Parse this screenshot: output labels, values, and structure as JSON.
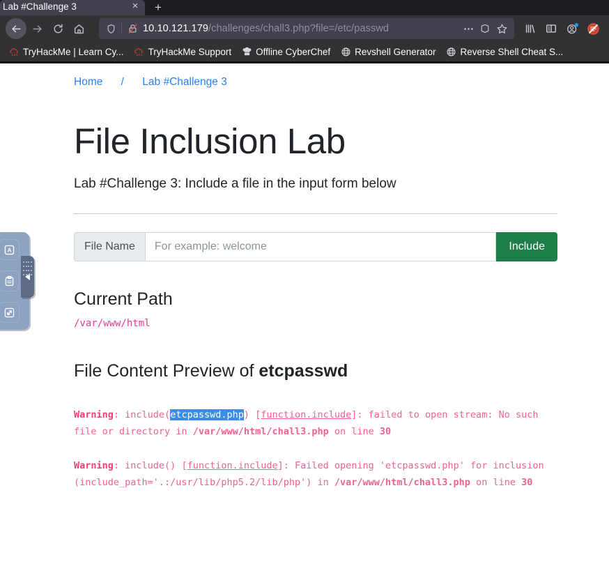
{
  "browser": {
    "tab": {
      "title": "Lab #Challenge 3",
      "close_label": "×"
    },
    "newtab_label": "+",
    "nav": {
      "back": "back-arrow",
      "forward": "forward-arrow",
      "reload": "reload",
      "home": "home"
    },
    "url": {
      "host": "10.10.121.179",
      "path": "/challenges/chall3.php?file=/etc/passwd",
      "shield_icon": "tracking-protection-shield",
      "lock_icon": "insecure-connection-crossed-lock",
      "page_actions_icon": "ellipsis",
      "reader_icon": "reader-view",
      "bookmark_icon": "star"
    },
    "toolbar_right": [
      {
        "name": "library-icon",
        "glyph": "library"
      },
      {
        "name": "sidebar-icon",
        "glyph": "sidebar"
      },
      {
        "name": "account-icon",
        "glyph": "account"
      },
      {
        "name": "noscript-icon",
        "glyph": "noscript"
      }
    ],
    "bookmarks": [
      {
        "label": "TryHackMe | Learn Cy...",
        "icon": "tryhackme-cloud-icon"
      },
      {
        "label": "TryHackMe Support",
        "icon": "tryhackme-cloud-icon"
      },
      {
        "label": "Offline CyberChef",
        "icon": "chef-hat-icon"
      },
      {
        "label": "Revshell Generator",
        "icon": "globe-icon"
      },
      {
        "label": "Reverse Shell Cheat S...",
        "icon": "globe-icon"
      }
    ]
  },
  "page": {
    "breadcrumb": {
      "home": "Home",
      "separator": "/",
      "current": "Lab #Challenge 3"
    },
    "title": "File Inclusion Lab",
    "lead": "Lab #Challenge 3: Include a file in the input form below",
    "form": {
      "prepend_label": "File Name",
      "input_value": "",
      "input_placeholder": "For example: welcome",
      "submit_label": "Include"
    },
    "current_path": {
      "heading": "Current Path",
      "value": "/var/www/html"
    },
    "preview": {
      "heading_prefix": "File Content Preview of ",
      "filename": "etcpasswd"
    },
    "warnings": [
      {
        "label": "Warning",
        "seg1": ": include(",
        "selected": "etcpasswd.php",
        "seg2": ") [",
        "link": "function.include",
        "seg3": "]: failed to open stream: No such file or directory in ",
        "bold_path": "/var/www/html/chall3.php",
        "seg4": " on line ",
        "line": "30"
      },
      {
        "label": "Warning",
        "seg1": ": include() [",
        "link": "function.include",
        "seg2": "]: Failed opening 'etcpasswd.php' for inclusion (include_path='.:/usr/lib/php5.2/lib/php') in ",
        "bold_path": "/var/www/html/chall3.php",
        "seg3": " on line ",
        "line": "30"
      }
    ]
  },
  "widget": {
    "buttons": [
      {
        "name": "text-tool-icon",
        "glyph": "A"
      },
      {
        "name": "clipboard-icon",
        "glyph": "clipboard"
      },
      {
        "name": "fullscreen-icon",
        "glyph": "expand"
      }
    ],
    "handle": {
      "name": "collapse-handle",
      "glyph": "◀"
    }
  },
  "colors": {
    "accent_green": "#1e7e48",
    "link_blue": "#2a7fff",
    "warning_pink": "#f06292",
    "path_pink": "#e83e8c",
    "selection_blue": "#3d8bea"
  }
}
